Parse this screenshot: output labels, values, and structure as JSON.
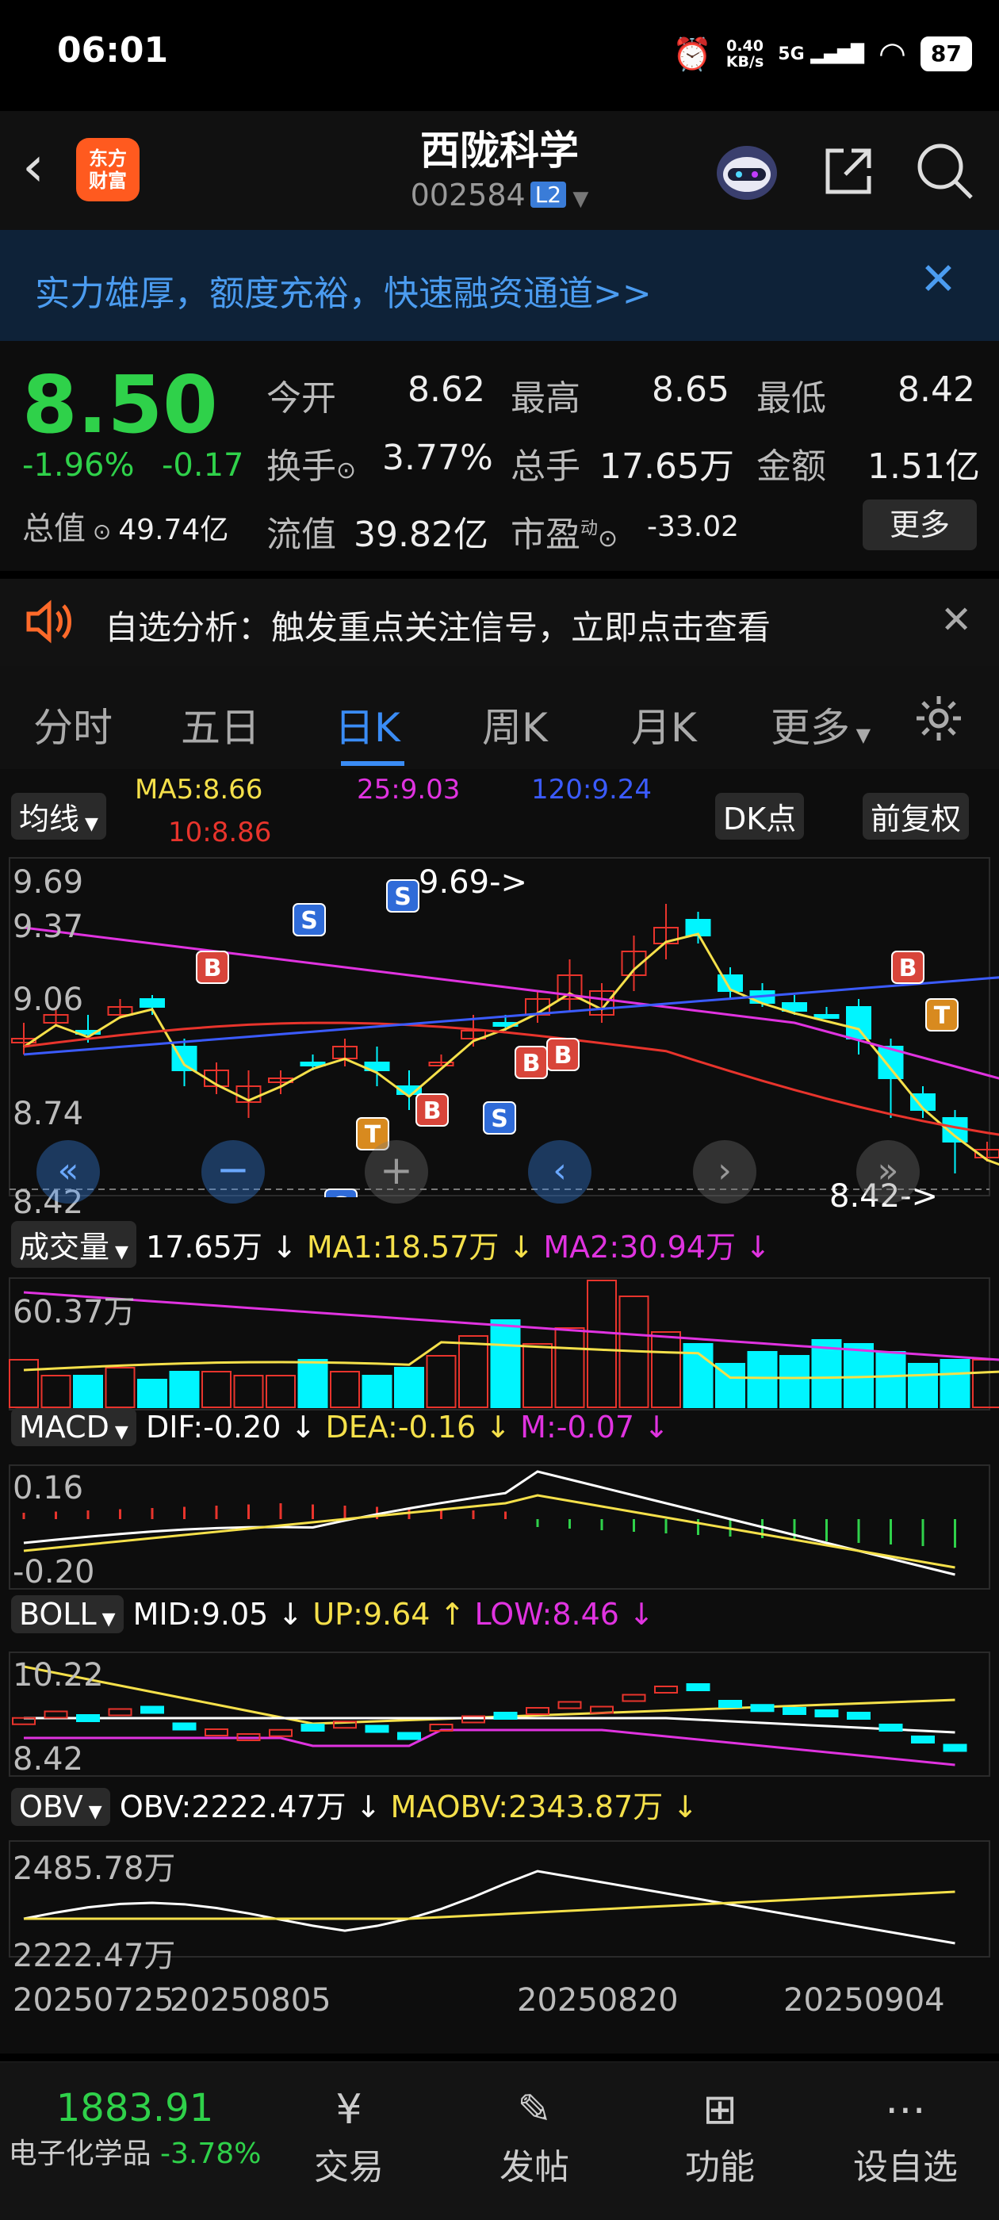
{
  "status": {
    "time": "06:01",
    "net_speed_value": "0.40",
    "net_speed_unit": "KB/s",
    "signal": "5G",
    "battery": "87"
  },
  "header": {
    "logo_line1": "东方",
    "logo_line2": "财富",
    "title": "西陇科学",
    "code": "002584",
    "badge": "L2"
  },
  "banner": {
    "text": "实力雄厚，额度充裕，快速融资通道>>"
  },
  "quote": {
    "price": "8.50",
    "change_pct": "-1.96%",
    "change": "-0.17",
    "open_label": "今开",
    "open": "8.62",
    "high_label": "最高",
    "high": "8.65",
    "low_label": "最低",
    "low": "8.42",
    "turnover_label": "换手",
    "turnover": "3.77%",
    "volume_label": "总手",
    "volume": "17.65万",
    "amount_label": "金额",
    "amount": "1.51亿",
    "mktcap_label": "总值",
    "mktcap": "49.74亿",
    "float_label": "流值",
    "float_cap": "39.82亿",
    "pe_label": "市盈",
    "pe_sup": "动",
    "pe": "-33.02",
    "more": "更多"
  },
  "tip": {
    "text": "自选分析：触发重点关注信号，立即点击查看"
  },
  "tabs": [
    "分时",
    "五日",
    "日K",
    "周K",
    "月K",
    "更多"
  ],
  "ma": {
    "selector": "均线",
    "ma5": "MA5:8.66",
    "ma10": "10:8.86",
    "ma25": "25:9.03",
    "ma120": "120:9.24",
    "dk": "DK点",
    "adjust": "前复权"
  },
  "kline": {
    "y_labels": [
      "9.69",
      "9.37",
      "9.06",
      "8.74",
      "8.42"
    ],
    "max_label": "9.69->",
    "min_label": "8.42->",
    "signals": [
      {
        "t": "S"
      },
      {
        "t": "S"
      },
      {
        "t": "B"
      },
      {
        "t": "B"
      },
      {
        "t": "T"
      },
      {
        "t": "B"
      },
      {
        "t": "S"
      },
      {
        "t": "B"
      },
      {
        "t": "S"
      },
      {
        "t": "B"
      },
      {
        "t": "T"
      }
    ]
  },
  "volume": {
    "selector": "成交量",
    "vol": "17.65万",
    "ma1": "MA1:18.57万",
    "ma2": "MA2:30.94万",
    "y_label": "60.37万"
  },
  "macd": {
    "selector": "MACD",
    "dif": "DIF:-0.20",
    "dea": "DEA:-0.16",
    "m": "M:-0.07",
    "y_top": "0.16",
    "y_bot": "-0.20"
  },
  "boll": {
    "selector": "BOLL",
    "mid": "MID:9.05",
    "up": "UP:9.64",
    "low": "LOW:8.46",
    "y_top": "10.22",
    "y_bot": "8.42"
  },
  "obv": {
    "selector": "OBV",
    "obv": "OBV:2222.47万",
    "maobv": "MAOBV:2343.87万",
    "y_top": "2485.78万",
    "y_bot": "2222.47万"
  },
  "dates": [
    "20250725",
    "20250805",
    "20250820",
    "20250904"
  ],
  "bottom_nav": {
    "index_value": "1883.91",
    "index_name": "电子化学品",
    "index_change": "-3.78%",
    "items": [
      "交易",
      "发帖",
      "功能",
      "设自选"
    ]
  },
  "colors": {
    "up": "#e8342c",
    "down": "#00f5ff",
    "green": "#2fd14a",
    "ma5": "#f5e04a",
    "ma10": "#e8342c",
    "ma25": "#e033e0",
    "ma120": "#3b5bff"
  }
}
